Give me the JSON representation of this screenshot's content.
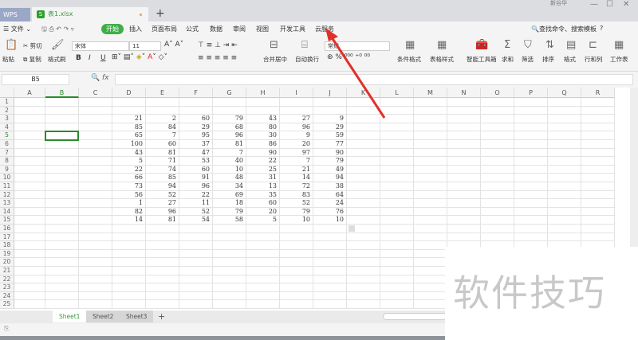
{
  "titlebar": {
    "wps_tab": "WPS",
    "file_tab": "表1.xlsx",
    "file_icon": "S",
    "new_tab": "+",
    "user": "新谷华",
    "min": "—",
    "max": "☐",
    "close": "✕"
  },
  "menu": {
    "file": "文件",
    "items": [
      "开始",
      "插入",
      "页面布局",
      "公式",
      "数据",
      "审阅",
      "视图",
      "开发工具",
      "云服务"
    ],
    "search": "查找命令、搜索模板",
    "help": "?"
  },
  "toolbar": {
    "paste": "粘贴",
    "cut": "剪切",
    "copy": "复制",
    "format_painter": "格式刷",
    "font": "宋体",
    "size": "11",
    "bold": "B",
    "italic": "I",
    "underline": "U",
    "merge": "合并居中",
    "wrap": "自动换行",
    "number_format": "常规",
    "cond_format": "条件格式",
    "table_style": "表格样式",
    "smart_toolbox": "智能工具箱",
    "sum": "求和",
    "filter": "筛选",
    "sort": "排序",
    "format": "格式",
    "rowcol": "行和列",
    "worksheet": "工作表"
  },
  "formula": {
    "name_box": "B5",
    "fx": "fx",
    "value": ""
  },
  "columns": [
    "A",
    "B",
    "C",
    "D",
    "E",
    "F",
    "G",
    "H",
    "I",
    "J",
    "K",
    "L",
    "M",
    "N",
    "O",
    "P",
    "Q",
    "R"
  ],
  "rows": 25,
  "data_start_row": 3,
  "table": [
    [
      21,
      2,
      60,
      79,
      43,
      27,
      9
    ],
    [
      85,
      84,
      29,
      68,
      80,
      96,
      29
    ],
    [
      65,
      7,
      95,
      96,
      30,
      9,
      59
    ],
    [
      100,
      60,
      37,
      81,
      86,
      20,
      77
    ],
    [
      43,
      81,
      47,
      7,
      90,
      97,
      90
    ],
    [
      5,
      71,
      53,
      40,
      22,
      7,
      79
    ],
    [
      22,
      74,
      60,
      10,
      25,
      21,
      49
    ],
    [
      66,
      85,
      91,
      48,
      31,
      14,
      94
    ],
    [
      73,
      94,
      96,
      34,
      13,
      72,
      38
    ],
    [
      56,
      52,
      22,
      69,
      35,
      83,
      64
    ],
    [
      1,
      27,
      11,
      18,
      60,
      52,
      24
    ],
    [
      82,
      96,
      52,
      79,
      20,
      79,
      76
    ],
    [
      14,
      81,
      54,
      58,
      5,
      10,
      10
    ]
  ],
  "sheets": [
    "Sheet1",
    "Sheet2",
    "Sheet3"
  ],
  "add_sheet": "+",
  "watermark": "软件技巧",
  "accent": "#3fae49"
}
